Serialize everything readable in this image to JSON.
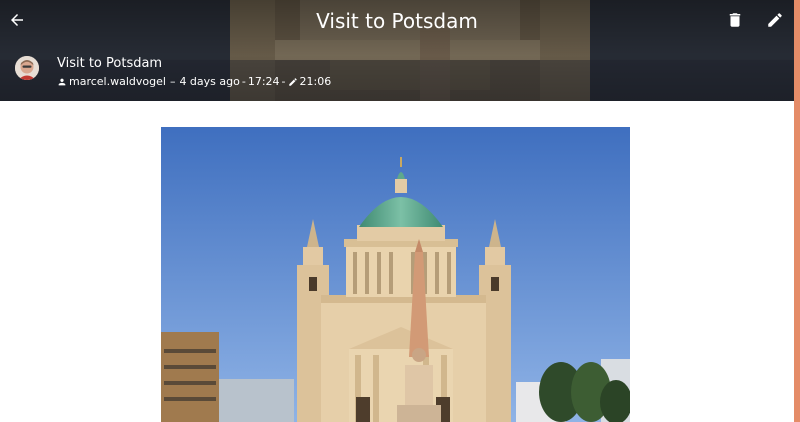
{
  "header": {
    "title": "Visit to Potsdam",
    "back_icon": "arrow-back-icon",
    "delete_icon": "trash-icon",
    "edit_icon": "pencil-icon"
  },
  "entry": {
    "title": "Visit to Potsdam",
    "author": "marcel.waldvogel",
    "separator1": "–",
    "age": "4 days ago",
    "separator2": "-",
    "time": "17:24",
    "separator3": "-",
    "edited_time": "21:06",
    "author_icon": "person-icon",
    "edited_icon": "pencil-icon"
  },
  "colors": {
    "accent": "#e58c68",
    "sky": "#4a78c4",
    "dome": "#5ea88c",
    "stone": "#e2c9a3"
  }
}
